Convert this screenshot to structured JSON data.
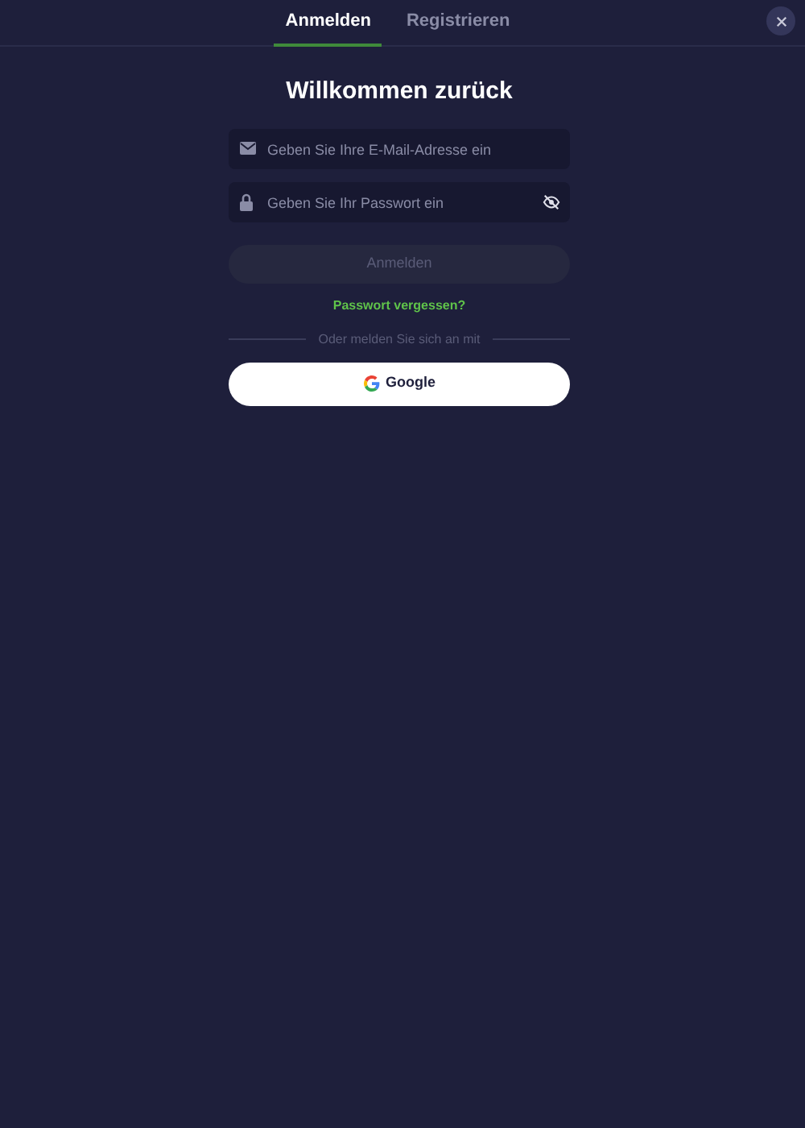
{
  "tabs": [
    {
      "label": "Anmelden",
      "selected": true
    },
    {
      "label": "Registrieren",
      "selected": false
    }
  ],
  "title": "Willkommen zurück",
  "fields": [
    {
      "kind": "email",
      "placeholder": "Geben Sie Ihre E-Mail-Adresse ein"
    },
    {
      "kind": "password",
      "placeholder": "Geben Sie Ihr Passwort ein"
    }
  ],
  "submit": {
    "label": "Anmelden",
    "disabled": true
  },
  "forgot_link": "Passwort vergessen?",
  "divider_text": "Oder melden Sie sich an mit",
  "google_button": "Google"
}
